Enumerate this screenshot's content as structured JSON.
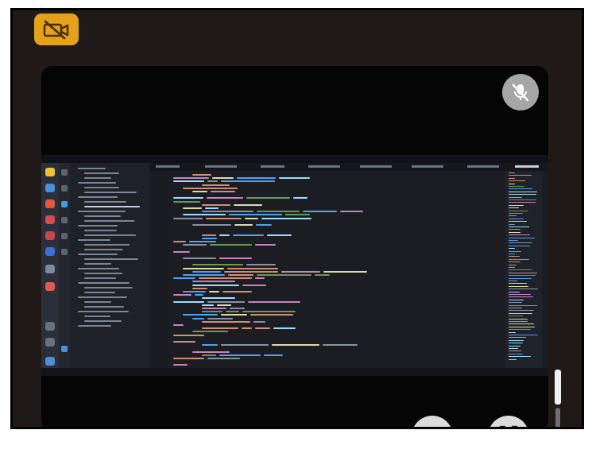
{
  "app": {
    "camera_button": {
      "icon": "camera-off-icon",
      "color": "#e4a11a",
      "state": "off"
    },
    "mute_button": {
      "icon": "microphone-off-icon",
      "color": "#a6a6a6",
      "state": "muted"
    },
    "shared_screen": {
      "content": "code-editor",
      "theme": "dark"
    },
    "bottom_controls": [
      {
        "icon": "share-screen-icon"
      },
      {
        "icon": "fullscreen-icon"
      }
    ]
  },
  "colors": {
    "background": "#1f1a18",
    "viewer": "#050505",
    "accent": "#e4a11a",
    "editor_bg": "#1b1d22"
  }
}
